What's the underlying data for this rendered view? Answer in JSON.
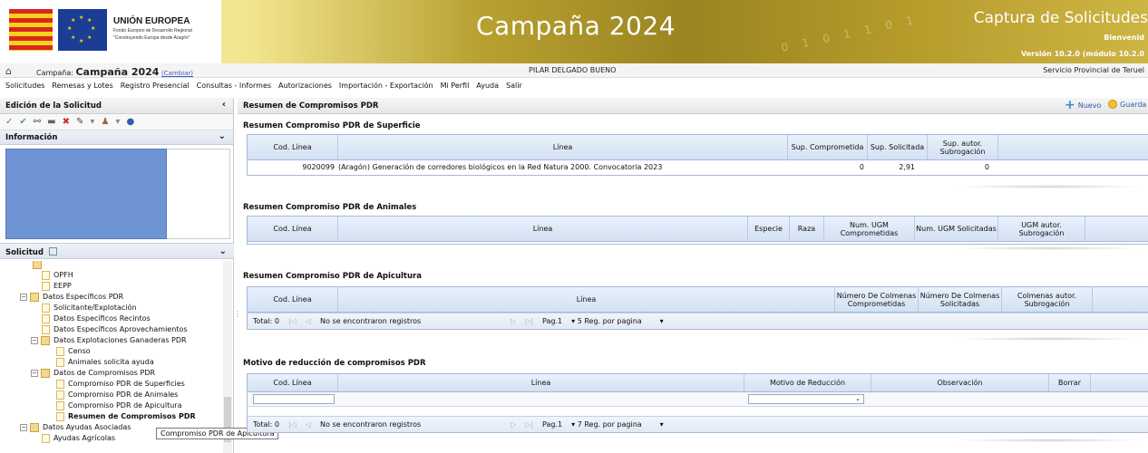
{
  "header": {
    "eu_title": "UNIÓN EUROPEA",
    "eu_line1": "Fondo Europeo de Desarrollo Regional",
    "eu_line2": "\"Construyendo Europa desde Aragón\"",
    "campaign_title": "Campaña 2024",
    "app_title": "Captura de Solicitudes",
    "welcome": "Bienvenid",
    "version": "Versión 10.2.0 (módulo 10.2.0"
  },
  "infobar": {
    "campaign_label": "Campaña:",
    "campaign_value": "Campaña 2024",
    "change_link": "(Cambiar)",
    "user_name": "PILAR DELGADO BUENO",
    "service": "Servicio Provincial de Teruel"
  },
  "menu": [
    "Solicitudes",
    "Remesas y Lotes",
    "Registro Presencial",
    "Consultas - Informes",
    "Autorizaciones",
    "Importación - Exportación",
    "Mi Perfil",
    "Ayuda",
    "Salir"
  ],
  "left_panel": {
    "title": "Edición de la Solicitud",
    "info_title": "Información",
    "solicitud_title": "Solicitud",
    "tree": [
      {
        "label": "OPFH",
        "level": 2,
        "type": "doc"
      },
      {
        "label": "EEPP",
        "level": 2,
        "type": "doc"
      },
      {
        "label": "Datos Específicos PDR",
        "level": 1,
        "type": "folder"
      },
      {
        "label": "Solicitante/Explotación",
        "level": 2,
        "type": "doc"
      },
      {
        "label": "Datos Específicos Recintos",
        "level": 2,
        "type": "doc"
      },
      {
        "label": "Datos Específicos Aprovechamientos",
        "level": 2,
        "type": "doc"
      },
      {
        "label": "Datos Explotaciones Ganaderas PDR",
        "level": 2,
        "type": "folder"
      },
      {
        "label": "Censo",
        "level": 3,
        "type": "doc"
      },
      {
        "label": "Animales solicita ayuda",
        "level": 3,
        "type": "doc"
      },
      {
        "label": "Datos de Compromisos PDR",
        "level": 2,
        "type": "folder"
      },
      {
        "label": "Compromiso PDR de Superficies",
        "level": 3,
        "type": "doc"
      },
      {
        "label": "Compromiso PDR de Animales",
        "level": 3,
        "type": "doc"
      },
      {
        "label": "Compromiso PDR de Apicultura",
        "level": 3,
        "type": "doc"
      },
      {
        "label": "Resumen de Compromisos PDR",
        "level": 3,
        "type": "doc",
        "selected": true
      },
      {
        "label": "Datos Ayudas Asociadas",
        "level": 1,
        "type": "folder"
      },
      {
        "label": "Ayudas Agrícolas",
        "level": 2,
        "type": "doc"
      }
    ],
    "tooltip": "Compromiso PDR de Apicultura"
  },
  "main": {
    "title": "Resumen de Compromisos PDR",
    "new_label": "Nuevo",
    "save_label": "Guarda",
    "superficie": {
      "title": "Resumen Compromiso PDR de Superficie",
      "columns": [
        "Cod. Línea",
        "Línea",
        "Sup. Comprometida",
        "Sup. Solicitada",
        "Sup. autor. Subrogación"
      ],
      "row": {
        "cod": "9020099",
        "linea": "(Aragón) Generación de corredores biológicos en la Red Natura 2000. Convocatoria 2023",
        "comprometida": "0",
        "solicitada": "2,91",
        "subrogacion": "0"
      }
    },
    "animales": {
      "title": "Resumen Compromiso PDR de Animales",
      "columns": [
        "Cod. Línea",
        "Línea",
        "Especie",
        "Raza",
        "Num. UGM Comprometidas",
        "Num. UGM Solicitadas",
        "UGM autor. Subrogación"
      ]
    },
    "apicultura": {
      "title": "Resumen Compromiso PDR de Apicultura",
      "columns": [
        "Cod. Línea",
        "Línea",
        "Número De Colmenas Comprometidas",
        "Número De Colmenas Solicitadas",
        "Colmenas autor. Subrogación"
      ],
      "pager": {
        "total": "Total: 0",
        "message": "No se encontraron registros",
        "page": "Pag.1",
        "per_page": "5 Reg. por pagina"
      }
    },
    "motivo": {
      "title": "Motivo de reducción de compromisos PDR",
      "columns": [
        "Cod. Línea",
        "Línea",
        "Motivo de Reducción",
        "Observación",
        "Borrar"
      ],
      "pager": {
        "total": "Total: 0",
        "message": "No se encontraron registros",
        "page": "Pag.1",
        "per_page": "7 Reg. por pagina"
      }
    }
  }
}
